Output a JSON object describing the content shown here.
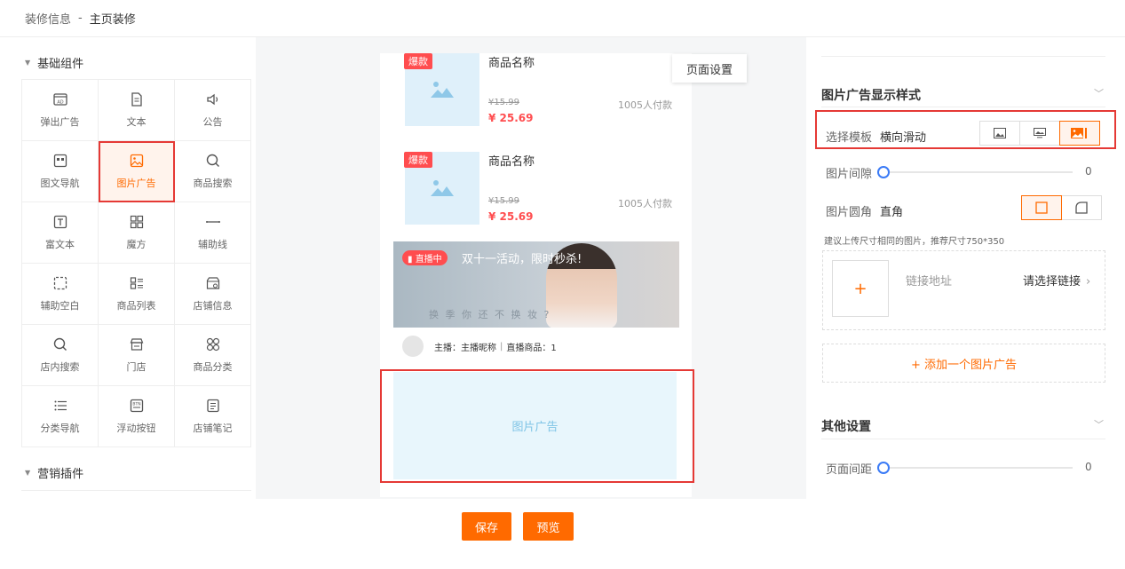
{
  "breadcrumb": {
    "parent": "装修信息",
    "separator": "-",
    "current": "主页装修"
  },
  "left": {
    "group1_title": "基础组件",
    "group2_title": "营销插件",
    "components": [
      {
        "label": "弹出广告",
        "icon": "ad-icon"
      },
      {
        "label": "文本",
        "icon": "document-icon"
      },
      {
        "label": "公告",
        "icon": "speaker-icon"
      },
      {
        "label": "图文导航",
        "icon": "image-nav-icon"
      },
      {
        "label": "图片广告",
        "icon": "image-icon"
      },
      {
        "label": "商品搜索",
        "icon": "search-icon"
      },
      {
        "label": "富文本",
        "icon": "text-box-icon"
      },
      {
        "label": "魔方",
        "icon": "cube-grid-icon"
      },
      {
        "label": "辅助线",
        "icon": "line-icon"
      },
      {
        "label": "辅助空白",
        "icon": "dashed-square-icon"
      },
      {
        "label": "商品列表",
        "icon": "list-icon"
      },
      {
        "label": "店铺信息",
        "icon": "shop-info-icon"
      },
      {
        "label": "店内搜索",
        "icon": "search-icon"
      },
      {
        "label": "门店",
        "icon": "store-icon"
      },
      {
        "label": "商品分类",
        "icon": "category-icon"
      },
      {
        "label": "分类导航",
        "icon": "bullet-list-icon"
      },
      {
        "label": "浮动按钮",
        "icon": "btn-icon"
      },
      {
        "label": "店铺笔记",
        "icon": "note-icon"
      }
    ]
  },
  "preview": {
    "products": [
      {
        "tag": "爆款",
        "name": "商品名称",
        "old_price": "¥15.99",
        "sold": "1005人付款",
        "price": "¥ 25.69"
      },
      {
        "tag": "爆款",
        "name": "商品名称",
        "old_price": "¥15.99",
        "sold": "1005人付款",
        "price": "¥ 25.69"
      }
    ],
    "live": {
      "badge": "直播中",
      "title": "双十一活动，限时秒杀!",
      "sub": "换 季 你 还 不 换 妆 ?",
      "anchor": "主播：主播昵称",
      "divider": "|",
      "count": "直播商品：1"
    },
    "ad_placeholder": "图片广告",
    "page_settings": "页面设置"
  },
  "buttons": {
    "save": "保存",
    "preview": "预览"
  },
  "right": {
    "section1_title": "图片广告显示样式",
    "template_label": "选择模板",
    "template_value": "横向滑动",
    "gap_label": "图片间隙",
    "gap_value": "0",
    "gap_level": 0,
    "corner_label": "图片圆角",
    "corner_value": "直角",
    "hint": "建议上传尺寸相同的图片，推荐尺寸750*350",
    "link_label": "链接地址",
    "link_select": "请选择链接",
    "add_ad": "+ 添加一个图片广告",
    "section2_title": "其他设置",
    "page_margin_label": "页面间距",
    "page_margin_value": "0",
    "page_margin_level": 0
  },
  "colors": {
    "accent": "#ff6a00",
    "highlight": "#e53935",
    "price": "#ff4d4f",
    "slider": "#3b7bf6"
  }
}
